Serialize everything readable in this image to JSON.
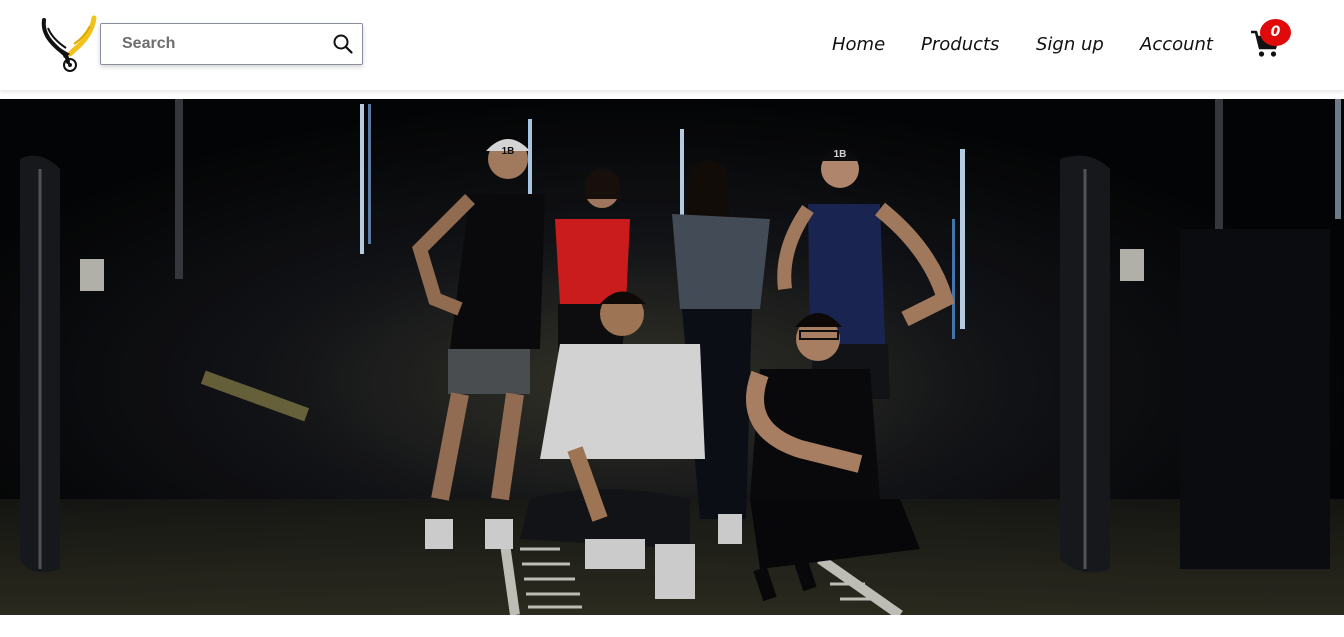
{
  "header": {
    "logo_icon": "bull-horns-logo-icon",
    "search": {
      "placeholder": "Search",
      "value": "",
      "icon": "search-icon"
    },
    "nav": [
      {
        "label": "Home"
      },
      {
        "label": "Products"
      },
      {
        "label": "Sign up"
      },
      {
        "label": "Account"
      }
    ],
    "cart": {
      "icon": "cart-icon",
      "count": "0",
      "badge_color": "#e00a0a"
    }
  },
  "hero": {
    "image": "group-of-athletes-in-dark-gym-photo",
    "cap_text": "1B"
  },
  "colors": {
    "header_bg": "#ffffff",
    "nav_text": "#111111",
    "logo_accent": "#f2c21b",
    "hero_bg": "#050608"
  }
}
